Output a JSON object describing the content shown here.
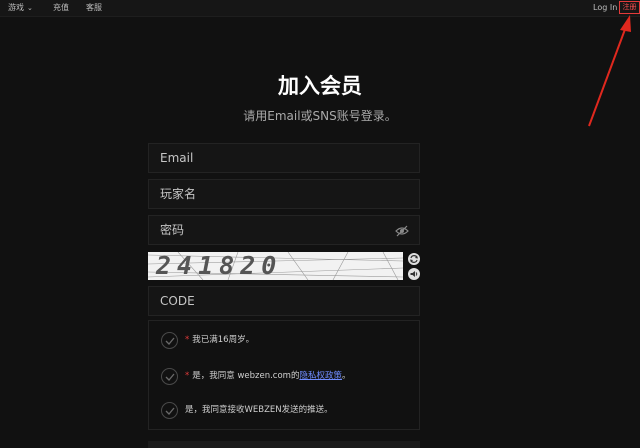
{
  "topnav": {
    "items": [
      {
        "label": "游戏",
        "has_dropdown": true
      },
      {
        "label": "充值",
        "has_dropdown": false
      },
      {
        "label": "客服",
        "has_dropdown": false
      }
    ],
    "login_label": "Log In",
    "register_label": "注册"
  },
  "page": {
    "title": "加入会员",
    "subtitle": "请用Email或SNS账号登录。"
  },
  "form": {
    "email_placeholder": "Email",
    "username_placeholder": "玩家名",
    "password_placeholder": "密码",
    "captcha_text": "241820",
    "code_placeholder": "CODE"
  },
  "terms": [
    {
      "required": true,
      "text": "我已满16周岁。",
      "link": "",
      "suffix": ""
    },
    {
      "required": true,
      "text": "是，我同意 webzen.com的",
      "link": "隐私权政策",
      "suffix": "。"
    },
    {
      "required": false,
      "text": "是，我同意接收WEBZEN发送的推送。",
      "link": "",
      "suffix": ""
    }
  ],
  "colors": {
    "background": "#111111",
    "accent_red": "#e23a3a",
    "link_blue": "#6f8cff"
  },
  "icons": {
    "password_toggle": "eye-slash-icon",
    "captcha_refresh": "refresh-icon",
    "captcha_audio": "audio-icon",
    "check": "check-icon"
  }
}
